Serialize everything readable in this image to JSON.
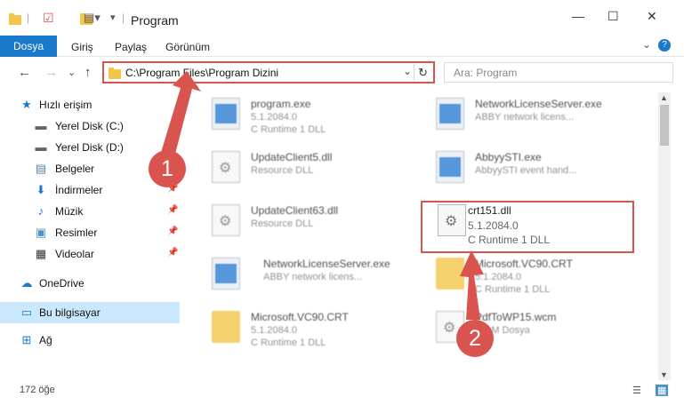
{
  "window": {
    "title": "Program",
    "minimize": "—",
    "maximize": "☐",
    "close": "✕"
  },
  "ribbon": {
    "tabs": [
      "Dosya",
      "Giriş",
      "Paylaş",
      "Görünüm"
    ],
    "expand": "⌄",
    "help": "?"
  },
  "nav": {
    "back": "←",
    "forward": "→",
    "recent": "⌄",
    "up": "↑"
  },
  "address": {
    "path": "C:\\Program Files\\Program Dizini",
    "dropdown": "⌄",
    "refresh": "↻"
  },
  "search": {
    "placeholder": "Ara: Program"
  },
  "sidebar": {
    "items": [
      {
        "label": "Hızlı erişim",
        "icon": "star-icon",
        "glyph": "★",
        "color": "#1979ca",
        "pin": ""
      },
      {
        "label": "Yerel Disk (C:)",
        "icon": "drive-icon",
        "glyph": "▬",
        "color": "#666",
        "pin": ""
      },
      {
        "label": "Yerel Disk (D:)",
        "icon": "drive-icon",
        "glyph": "▬",
        "color": "#666",
        "pin": ""
      },
      {
        "label": "Belgeler",
        "icon": "documents-icon",
        "glyph": "▤",
        "color": "#5a7fa8",
        "pin": "📌"
      },
      {
        "label": "İndirmeler",
        "icon": "download-icon",
        "glyph": "⬇",
        "color": "#1979ca",
        "pin": "📌"
      },
      {
        "label": "Müzik",
        "icon": "music-icon",
        "glyph": "♪",
        "color": "#1979ca",
        "pin": "📌"
      },
      {
        "label": "Resimler",
        "icon": "pictures-icon",
        "glyph": "▣",
        "color": "#4a8fc5",
        "pin": "📌"
      },
      {
        "label": "Videolar",
        "icon": "video-icon",
        "glyph": "▦",
        "color": "#333",
        "pin": "📌"
      },
      {
        "label": "OneDrive",
        "icon": "cloud-icon",
        "glyph": "☁",
        "color": "#1979ca",
        "pin": ""
      },
      {
        "label": "Bu bilgisayar",
        "icon": "computer-icon",
        "glyph": "▭",
        "color": "#1979ca",
        "pin": ""
      },
      {
        "label": "Ağ",
        "icon": "network-icon",
        "glyph": "⊞",
        "color": "#1979ca",
        "pin": ""
      }
    ]
  },
  "files": [
    {
      "name": "program.exe",
      "line2": "5.1.2084.0",
      "line3": "C Runtime 1 DLL",
      "type": "exe"
    },
    {
      "name": "NetworkLicenseServer.exe",
      "line2": "ABBY network licens...",
      "line3": "",
      "type": "exe"
    },
    {
      "name": "UpdateClient5.dll",
      "line2": "Resource DLL",
      "line3": "",
      "type": "dll"
    },
    {
      "name": "AbbyySTI.exe",
      "line2": "AbbyySTI event hand...",
      "line3": "",
      "type": "exe"
    },
    {
      "name": "UpdateClient63.dll",
      "line2": "Resource DLL",
      "line3": "",
      "type": "dll"
    },
    {
      "name": "crt151.dll",
      "line2": "5.1.2084.0",
      "line3": "C Runtime 1 DLL",
      "type": "dll"
    },
    {
      "name": "NetworkLicenseServer.exe",
      "line2": "ABBY network licens...",
      "line3": "",
      "type": "exe"
    },
    {
      "name": "Microsoft.VC90.CRT",
      "line2": "5.1.2084.0",
      "line3": "C Runtime 1 DLL",
      "type": "folder"
    },
    {
      "name": "Microsoft.VC90.CRT",
      "line2": "5.1.2084.0",
      "line3": "C Runtime 1 DLL",
      "type": "folder"
    },
    {
      "name": "PdfToWP15.wcm",
      "line2": "WCM Dosya",
      "line3": "",
      "type": "dll"
    }
  ],
  "status": {
    "count": "172 öğe",
    "details_view": "☰",
    "tiles_view": "▦"
  },
  "annotations": {
    "badge1": "1",
    "badge2": "2"
  },
  "colors": {
    "accent": "#1979ca",
    "highlight": "#d9534f",
    "selected": "#cce8ff"
  }
}
